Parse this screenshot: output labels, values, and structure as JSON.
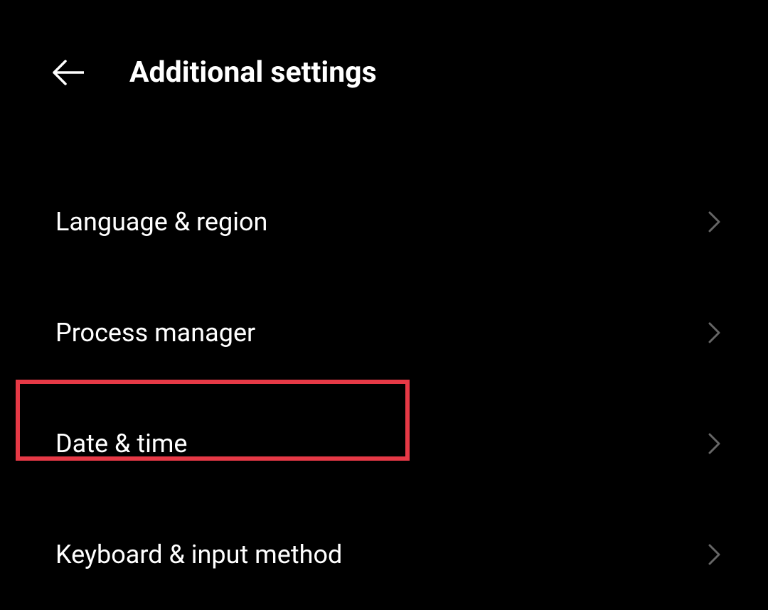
{
  "header": {
    "title": "Additional settings"
  },
  "settings": {
    "items": [
      {
        "label": "Language & region"
      },
      {
        "label": "Process manager"
      },
      {
        "label": "Date & time"
      },
      {
        "label": "Keyboard & input method"
      }
    ]
  }
}
